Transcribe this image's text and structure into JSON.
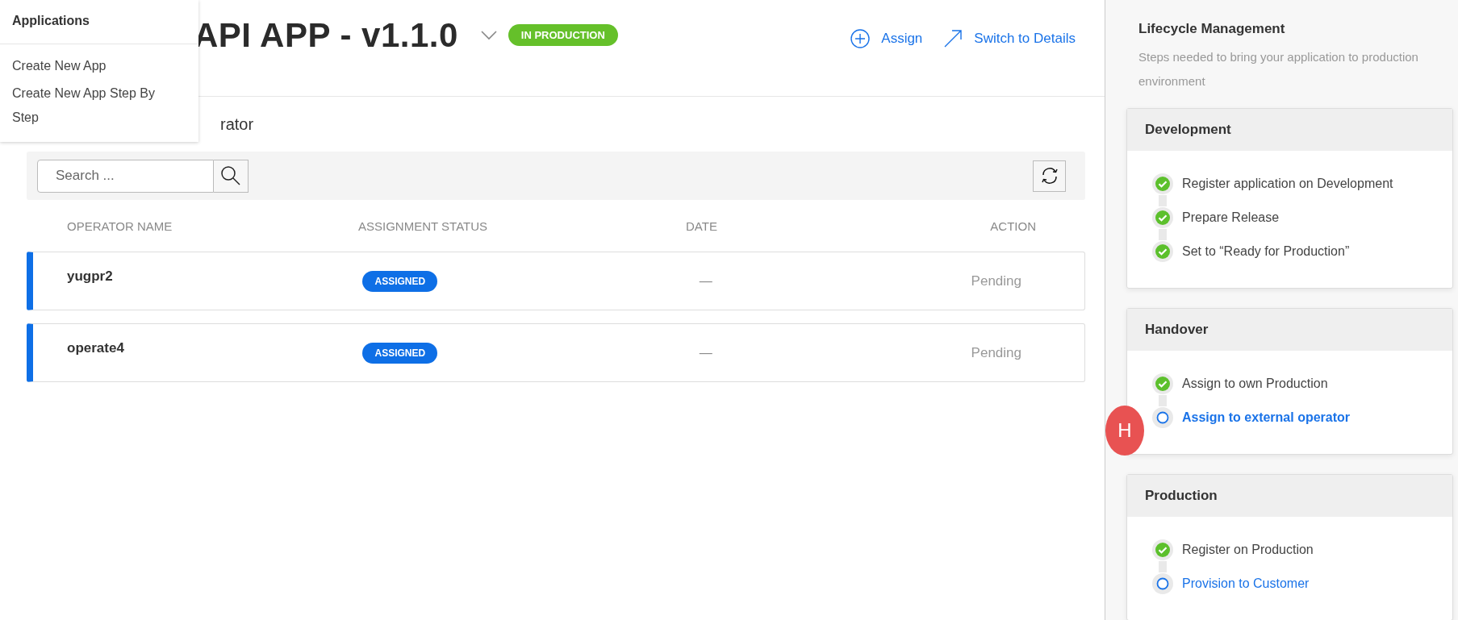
{
  "menu": {
    "title": "Applications",
    "items": [
      {
        "label": "Create New App"
      },
      {
        "label": "Create New App Step By Step"
      }
    ]
  },
  "header": {
    "title": "API APP - v1.1.0",
    "status_badge": "IN PRODUCTION",
    "actions": [
      {
        "kind": "assign",
        "label": "Assign"
      },
      {
        "kind": "switch",
        "label": "Switch to Details"
      }
    ]
  },
  "section_title": "rator",
  "search": {
    "placeholder": "Search ..."
  },
  "table": {
    "columns": [
      "OPERATOR NAME",
      "ASSIGNMENT STATUS",
      "DATE",
      "ACTION"
    ],
    "rows": [
      {
        "name": "yugpr2",
        "status": "ASSIGNED",
        "date": "—",
        "action": "Pending"
      },
      {
        "name": "operate4",
        "status": "ASSIGNED",
        "date": "—",
        "action": "Pending"
      }
    ]
  },
  "lifecycle": {
    "title": "Lifecycle Management",
    "description": "Steps needed to bring your application to production environment",
    "stages": [
      {
        "title": "Development",
        "steps": [
          {
            "label": "Register application on Development",
            "done": true,
            "current": false
          },
          {
            "label": "Prepare Release",
            "done": true,
            "current": false
          },
          {
            "label": "Set to “Ready for Production”",
            "done": true,
            "current": false
          }
        ]
      },
      {
        "title": "Handover",
        "steps": [
          {
            "label": "Assign to own Production",
            "done": true,
            "current": false
          },
          {
            "label": "Assign to external operator",
            "done": false,
            "current": true
          }
        ]
      },
      {
        "title": "Production",
        "steps": [
          {
            "label": "Register on Production",
            "done": true,
            "current": false
          },
          {
            "label": "Provision to Customer",
            "done": false,
            "current": false
          }
        ]
      }
    ]
  },
  "avatar": {
    "initial": "H"
  }
}
